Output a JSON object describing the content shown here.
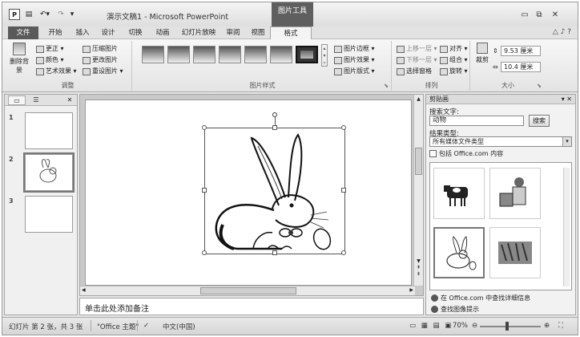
{
  "window": {
    "title": "演示文稿1 - Microsoft PowerPoint",
    "context_tab_title": "图片工具",
    "minimize": "▭",
    "restore": "⧉",
    "close": "✕"
  },
  "qat": {
    "app_icon": "P",
    "save": "▤",
    "undo": "↶▾",
    "redo": "↷",
    "more": "▾"
  },
  "tabs": [
    "文件",
    "开始",
    "插入",
    "设计",
    "切换",
    "动画",
    "幻灯片放映",
    "审阅",
    "视图",
    "格式"
  ],
  "ribbon_right": {
    "help": "♪ ?",
    "collapse": "△"
  },
  "ribbon": {
    "adjust": {
      "label": "调整",
      "remove_bg": "删除背景",
      "corrections": "更正 ▾",
      "color": "颜色 ▾",
      "artistic": "艺术效果 ▾",
      "compress": "压缩图片",
      "change": "更改图片",
      "reset": "重设图片 ▾"
    },
    "styles": {
      "label": "图片样式",
      "border": "图片边框 ▾",
      "effects": "图片效果 ▾",
      "layout": "图片版式 ▾"
    },
    "arrange": {
      "label": "排列",
      "bring_forward": "上移一层 ▾",
      "send_backward": "下移一层 ▾",
      "selection_pane": "选择窗格",
      "align": "对齐 ▾",
      "group": "组合 ▾",
      "rotate": "旋转 ▾"
    },
    "size": {
      "label": "大小",
      "crop": "裁剪",
      "height": "9.53 厘米",
      "width": "10.4 厘米"
    }
  },
  "slides_pane": {
    "slide_numbers": [
      "1",
      "2",
      "3"
    ]
  },
  "notes_placeholder": "单击此处添加备注",
  "clipart": {
    "title": "剪贴画",
    "search_label": "搜索文字:",
    "search_value": "动物",
    "search_button": "搜索",
    "result_type_label": "结果类型:",
    "result_type_value": "所有媒体文件类型",
    "include_office": "包括 Office.com 内容",
    "link_office": "在 Office.com 中查找详细信息",
    "link_tips": "查找图像提示"
  },
  "status": {
    "slide_info": "幻灯片 第 2 张，共 3 张",
    "theme": "\"Office 主题\"",
    "language": "中文(中国)",
    "zoom": "70%"
  }
}
